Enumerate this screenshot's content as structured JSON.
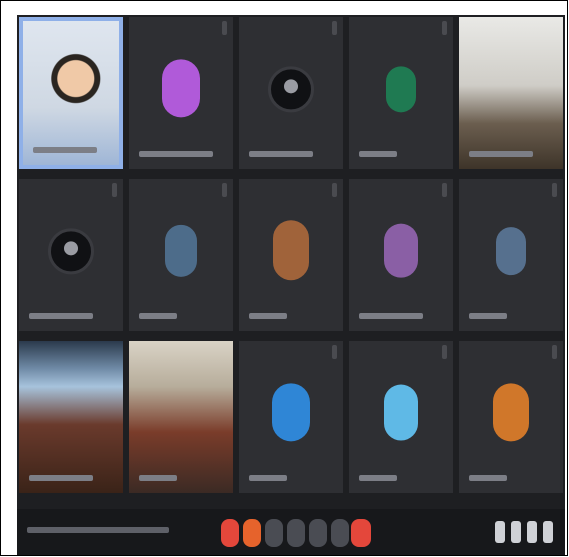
{
  "window": {
    "title": ""
  },
  "participants": [
    {
      "name": "",
      "type": "camera",
      "active": true
    },
    {
      "name": "",
      "type": "avatar",
      "color": "#b05ad9"
    },
    {
      "name": "",
      "type": "dark-avatar"
    },
    {
      "name": "",
      "type": "avatar",
      "color": "#1f7a52"
    },
    {
      "name": "",
      "type": "camera"
    },
    {
      "name": "",
      "type": "dark-avatar"
    },
    {
      "name": "",
      "type": "avatar",
      "color": "#4d6c8a"
    },
    {
      "name": "",
      "type": "avatar",
      "color": "#a0633a"
    },
    {
      "name": "",
      "type": "avatar",
      "color": "#8a5fa5"
    },
    {
      "name": "",
      "type": "avatar",
      "color": "#56708e"
    },
    {
      "name": "",
      "type": "camera"
    },
    {
      "name": "",
      "type": "camera"
    },
    {
      "name": "",
      "type": "avatar",
      "color": "#2f86d6"
    },
    {
      "name": "",
      "type": "avatar",
      "color": "#5fb9e6"
    },
    {
      "name": "",
      "type": "avatar",
      "color": "#d0772a"
    }
  ],
  "control_bar": {
    "meeting_info": "",
    "controls": [
      "mic-off",
      "camera-off",
      "captions",
      "raise-hand",
      "present",
      "more",
      "leave-call"
    ],
    "right_controls": [
      "info",
      "people",
      "chat",
      "activities"
    ]
  },
  "colors": {
    "background": "#1e1f22",
    "tile": "#2e2f33",
    "active_border": "#8fb0e8",
    "leave": "#e4473b"
  }
}
